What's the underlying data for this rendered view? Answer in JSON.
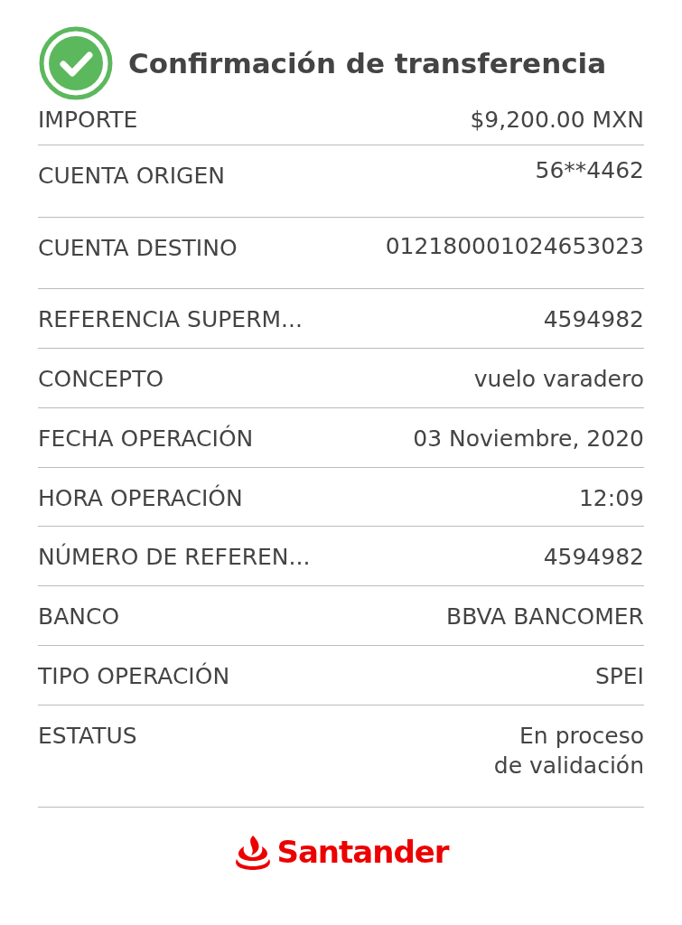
{
  "header": {
    "title": "Confirmación de transferencia",
    "success": true
  },
  "rows": [
    {
      "label": "IMPORTE",
      "value": [
        "$9,200.00 MXN"
      ],
      "kind": "short"
    },
    {
      "label": "CUENTA ORIGEN",
      "value": [
        "56**4462"
      ],
      "kind": "tall"
    },
    {
      "label": "CUENTA DESTINO",
      "value": [
        "012180001024653023"
      ],
      "kind": "tall"
    },
    {
      "label": "REFERENCIA SUPERM...",
      "value": [
        "4594982"
      ],
      "kind": "normal"
    },
    {
      "label": "CONCEPTO",
      "value": [
        "vuelo varadero"
      ],
      "kind": "normal"
    },
    {
      "label": "FECHA OPERACIÓN",
      "value": [
        "03 Noviembre, 2020"
      ],
      "kind": "normal"
    },
    {
      "label": "HORA OPERACIÓN",
      "value": [
        "12:09"
      ],
      "kind": "normal"
    },
    {
      "label": "NÚMERO DE REFEREN...",
      "value": [
        "4594982"
      ],
      "kind": "normal"
    },
    {
      "label": "BANCO",
      "value": [
        "BBVA BANCOMER"
      ],
      "kind": "normal"
    },
    {
      "label": "TIPO OPERACIÓN",
      "value": [
        "SPEI"
      ],
      "kind": "normal"
    },
    {
      "label": "ESTATUS",
      "value": [
        "En proceso",
        "de validación"
      ],
      "kind": "tall"
    }
  ],
  "footer": {
    "brand": "Santander"
  }
}
